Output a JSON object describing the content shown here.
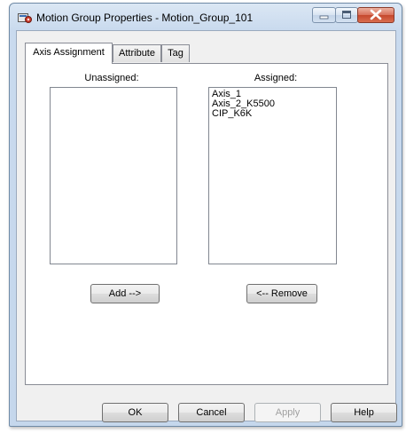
{
  "window": {
    "title": "Motion Group Properties - Motion_Group_101"
  },
  "tabs": [
    {
      "label": "Axis Assignment",
      "active": true
    },
    {
      "label": "Attribute",
      "active": false
    },
    {
      "label": "Tag",
      "active": false
    }
  ],
  "unassigned": {
    "label": "Unassigned:",
    "items": []
  },
  "assigned": {
    "label": "Assigned:",
    "items": [
      "Axis_1",
      "Axis_2_K5500",
      "CIP_K6K"
    ]
  },
  "buttons": {
    "add": "Add -->",
    "remove": "<-- Remove",
    "ok": "OK",
    "cancel": "Cancel",
    "apply": "Apply",
    "help": "Help"
  },
  "icons": {
    "title": "motion-group-icon",
    "minimize": "minimize-icon",
    "maximize": "maximize-icon",
    "close": "close-icon"
  },
  "colors": {
    "titlebar": "#c9daee",
    "close_button": "#c5472d",
    "dialog_face": "#f0f0f0"
  }
}
